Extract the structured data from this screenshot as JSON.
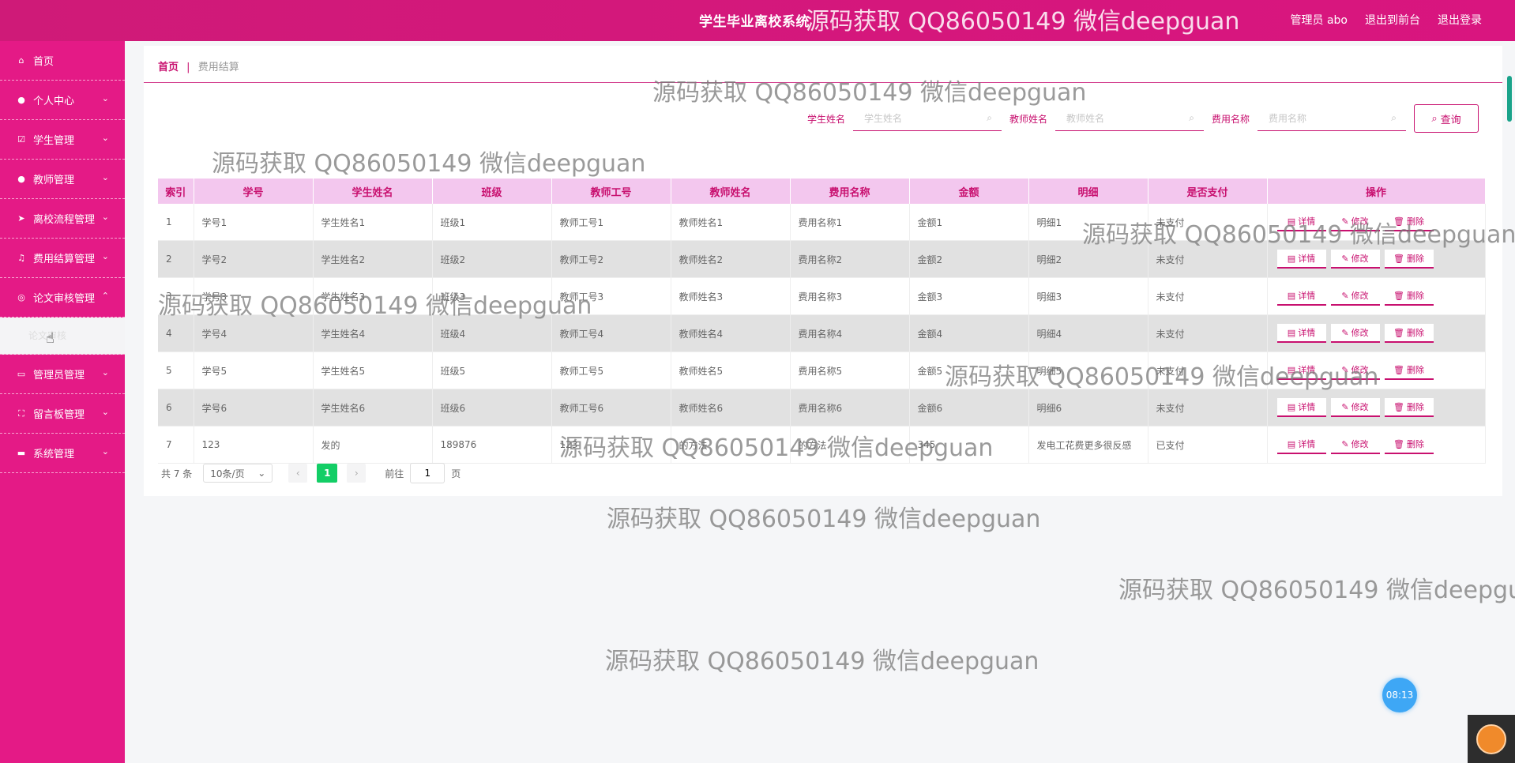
{
  "app": {
    "title": "学生毕业离校系统"
  },
  "topbar": {
    "user_label": "管理员 abo",
    "frontend_link": "退出到前台",
    "logout_link": "退出登录"
  },
  "sidebar": {
    "items": [
      {
        "label": "首页",
        "icon": "home-icon",
        "glyph": "⌂"
      },
      {
        "label": "个人中心",
        "icon": "user-icon",
        "glyph": "👤"
      },
      {
        "label": "学生管理",
        "icon": "checkbox-icon",
        "glyph": "☑"
      },
      {
        "label": "教师管理",
        "icon": "person-icon",
        "glyph": "👤"
      },
      {
        "label": "离校流程管理",
        "icon": "send-icon",
        "glyph": "➤"
      },
      {
        "label": "费用结算管理",
        "icon": "bell-icon",
        "glyph": "🔔"
      },
      {
        "label": "论文审核管理",
        "icon": "circle-icon",
        "glyph": "◎"
      },
      {
        "label": "管理员管理",
        "icon": "chat-icon",
        "glyph": "💬"
      },
      {
        "label": "留言板管理",
        "icon": "expand-icon",
        "glyph": "⛶"
      },
      {
        "label": "系统管理",
        "icon": "briefcase-icon",
        "glyph": "💼"
      }
    ],
    "submenu_label": "论文审核"
  },
  "breadcrumb": {
    "home": "首页",
    "sep": "|",
    "current": "费用结算"
  },
  "search": {
    "student_label": "学生姓名",
    "student_placeholder": "学生姓名",
    "teacher_label": "教师姓名",
    "teacher_placeholder": "教师姓名",
    "fee_label": "费用名称",
    "fee_placeholder": "费用名称",
    "query_button": "查询"
  },
  "table": {
    "columns": [
      "索引",
      "学号",
      "学生姓名",
      "班级",
      "教师工号",
      "教师姓名",
      "费用名称",
      "金额",
      "明细",
      "是否支付",
      "操作"
    ],
    "rows": [
      [
        "1",
        "学号1",
        "学生姓名1",
        "班级1",
        "教师工号1",
        "教师姓名1",
        "费用名称1",
        "金额1",
        "明细1",
        "未支付"
      ],
      [
        "2",
        "学号2",
        "学生姓名2",
        "班级2",
        "教师工号2",
        "教师姓名2",
        "费用名称2",
        "金额2",
        "明细2",
        "未支付"
      ],
      [
        "3",
        "学号3",
        "学生姓名3",
        "班级3",
        "教师工号3",
        "教师姓名3",
        "费用名称3",
        "金额3",
        "明细3",
        "未支付"
      ],
      [
        "4",
        "学号4",
        "学生姓名4",
        "班级4",
        "教师工号4",
        "教师姓名4",
        "费用名称4",
        "金额4",
        "明细4",
        "未支付"
      ],
      [
        "5",
        "学号5",
        "学生姓名5",
        "班级5",
        "教师工号5",
        "教师姓名5",
        "费用名称5",
        "金额5",
        "明细5",
        "未支付"
      ],
      [
        "6",
        "学号6",
        "学生姓名6",
        "班级6",
        "教师工号6",
        "教师姓名6",
        "费用名称6",
        "金额6",
        "明细6",
        "未支付"
      ],
      [
        "7",
        "123",
        "发的",
        "189876",
        "123",
        "的方法",
        "的方法",
        "345",
        "发电工花费更多很反感",
        "已支付"
      ]
    ],
    "ops": {
      "detail": "详情",
      "edit": "修改",
      "delete": "删除"
    }
  },
  "pagination": {
    "total": "共 7 条",
    "page_size": "10条/页",
    "current_page": "1",
    "goto_prefix": "前往",
    "goto_value": "1",
    "goto_suffix": "页"
  },
  "watermark": "源码获取 QQ86050149 微信deepguan",
  "widgets": {
    "time": "08:13"
  },
  "colors": {
    "brand": "#e41a86",
    "accent": "#c8106f",
    "header": "#f3c7ee",
    "current_page": "#13ce66"
  }
}
